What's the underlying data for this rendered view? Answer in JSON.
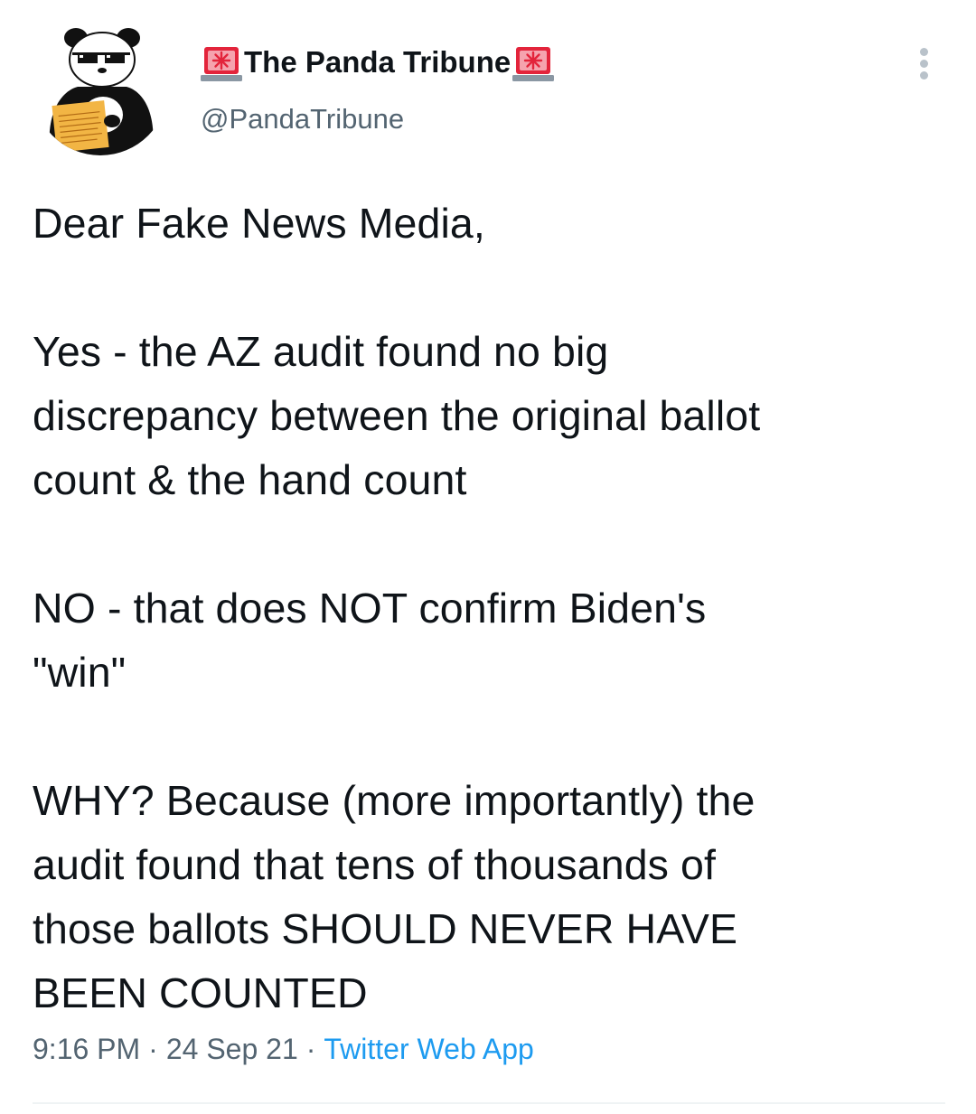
{
  "tweet": {
    "author": {
      "display_name": "The Panda Tribune",
      "handle": "@PandaTribune",
      "name_emoji_left": "siren-icon",
      "name_emoji_right": "siren-icon"
    },
    "menu_icon": "more-vertical-icon",
    "text": {
      "p1": [
        "Dear Fake News Media,"
      ],
      "p2": [
        "Yes - the AZ audit found no big",
        "discrepancy between the original ballot",
        "count & the hand count"
      ],
      "p3": [
        "NO - that does NOT confirm Biden's",
        "\"win\""
      ],
      "p4": [
        "WHY? Because (more importantly) the",
        "audit found that tens of thousands of",
        "those ballots SHOULD NEVER HAVE",
        "BEEN COUNTED"
      ]
    },
    "meta": {
      "time": "9:16 PM",
      "date": "24 Sep 21",
      "separator": "·",
      "source": "Twitter Web App"
    }
  },
  "colors": {
    "text_primary": "#0f1419",
    "text_secondary": "#536471",
    "link": "#1d9bf0",
    "siren_red": "#e3243b",
    "divider": "#eff3f4"
  }
}
